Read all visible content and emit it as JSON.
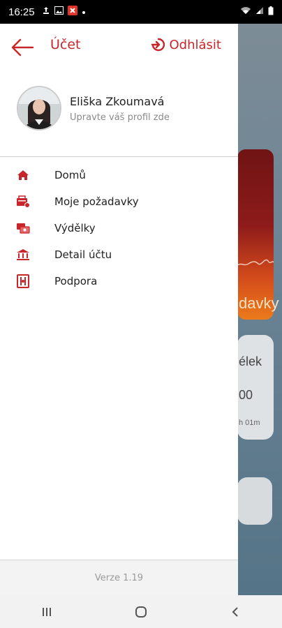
{
  "status_bar": {
    "time": "16:25",
    "left_icons": [
      "person-upload-icon",
      "image-icon",
      "app-x-icon",
      "dot-icon"
    ],
    "right_icons": [
      "wifi-icon",
      "signal-icon",
      "battery-icon"
    ]
  },
  "drawer": {
    "header": {
      "title": "Účet",
      "logout_label": "Odhlásit"
    },
    "profile": {
      "name": "Eliška Zkoumavá",
      "subtitle": "Upravte váš profil zde"
    },
    "menu": [
      {
        "label": "Domů",
        "icon": "home-icon"
      },
      {
        "label": "Moje požadavky",
        "icon": "requests-icon"
      },
      {
        "label": "Výdělky",
        "icon": "earnings-icon"
      },
      {
        "label": "Detail účtu",
        "icon": "bank-icon"
      },
      {
        "label": "Podpora",
        "icon": "support-icon"
      }
    ],
    "version": "Verze 1.19"
  },
  "background_app": {
    "red_card_text": "davky",
    "white_card_title": "élek",
    "white_card_value": "00",
    "white_card_time": "h 01m"
  },
  "colors": {
    "accent": "#c8262b",
    "drawer_bg": "#ffffff",
    "footer_bg": "#f3f3f3"
  }
}
